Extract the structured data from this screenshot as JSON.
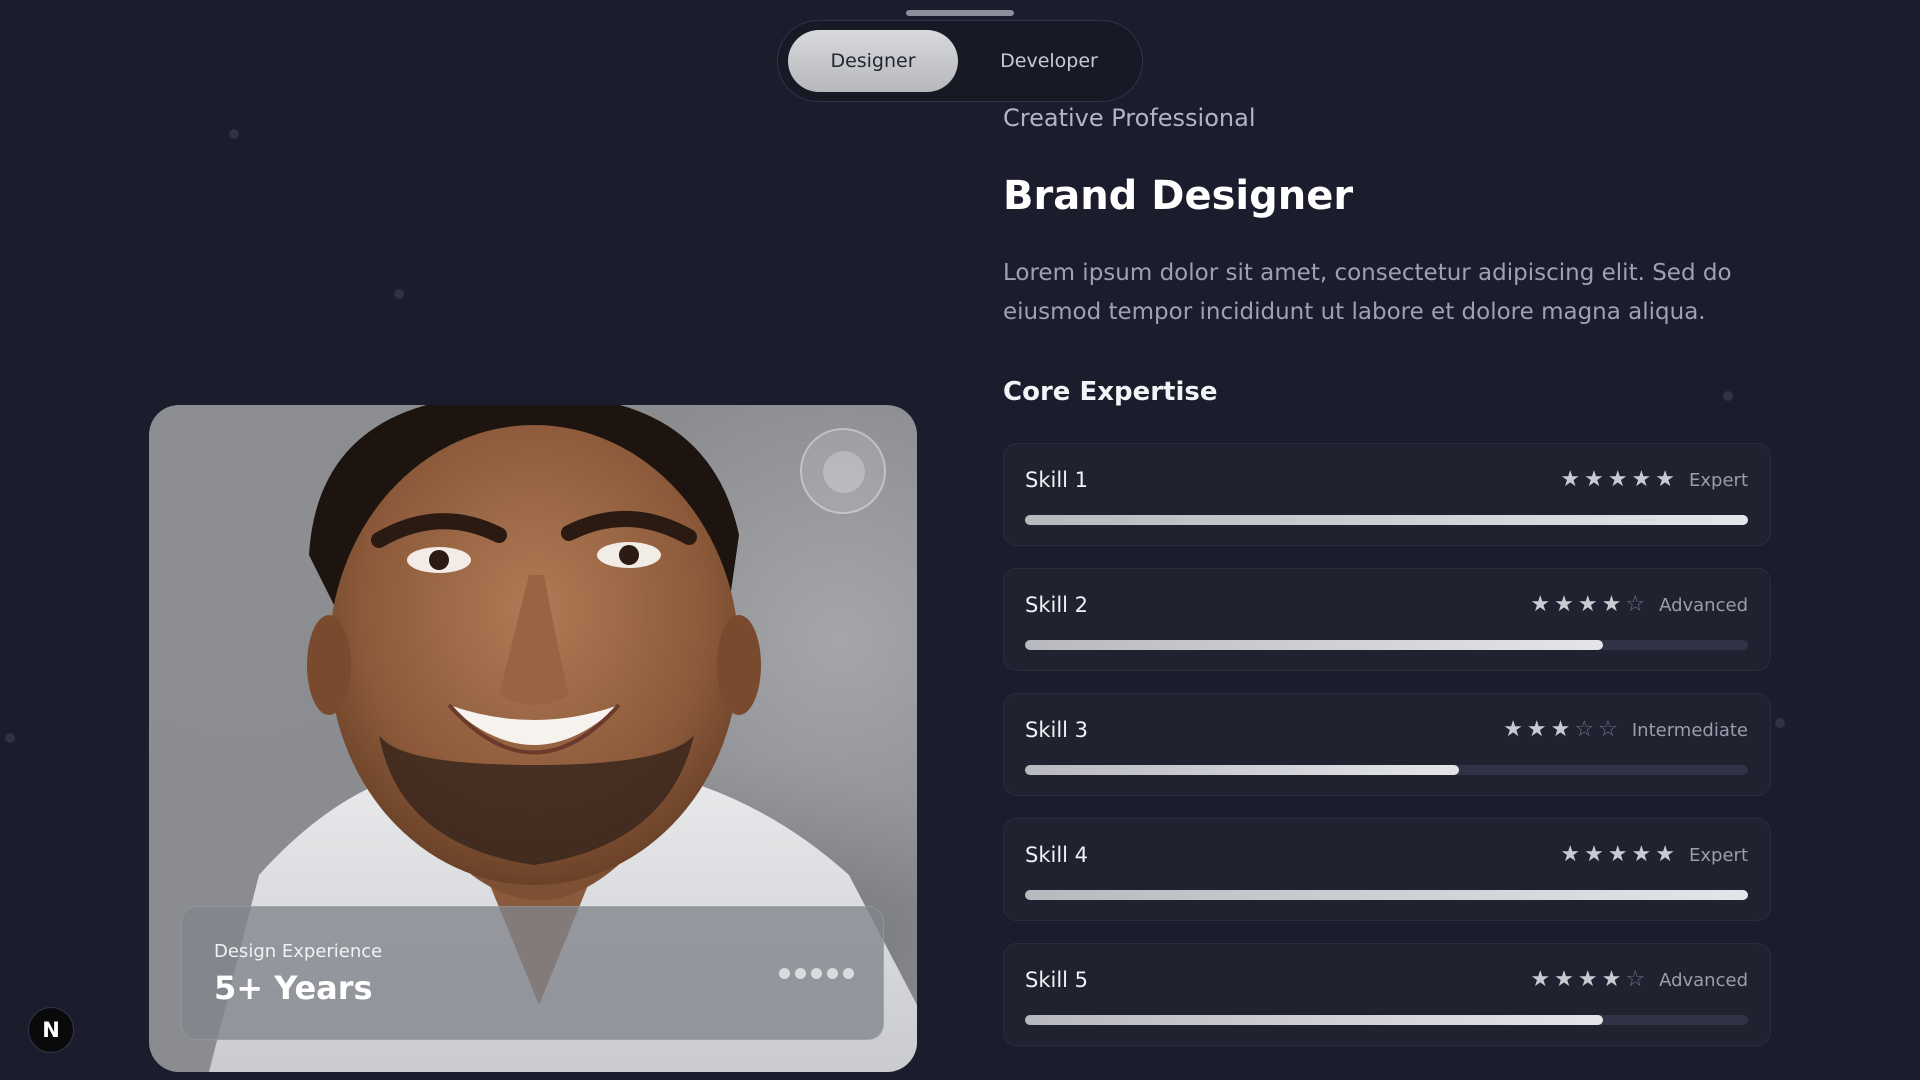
{
  "toggle": {
    "options": [
      {
        "label": "Designer",
        "active": true
      },
      {
        "label": "Developer",
        "active": false
      }
    ]
  },
  "profile": {
    "subtitle": "Creative Professional",
    "title": "Brand Designer",
    "description": "Lorem ipsum dolor sit amet, consectetur adipiscing elit. Sed do eiusmod tempor incididunt ut labore et dolore magna aliqua."
  },
  "photo_card": {
    "experience_label": "Design Experience",
    "experience_value": "5+ Years"
  },
  "expertise": {
    "title": "Core Expertise",
    "skills": [
      {
        "name": "Skill 1",
        "stars": 5,
        "max_stars": 5,
        "level": "Expert",
        "progress": 1.0
      },
      {
        "name": "Skill 2",
        "stars": 4,
        "max_stars": 5,
        "level": "Advanced",
        "progress": 0.8
      },
      {
        "name": "Skill 3",
        "stars": 3,
        "max_stars": 5,
        "level": "Intermediate",
        "progress": 0.6
      },
      {
        "name": "Skill 4",
        "stars": 5,
        "max_stars": 5,
        "level": "Expert",
        "progress": 1.0
      },
      {
        "name": "Skill 5",
        "stars": 4,
        "max_stars": 5,
        "level": "Advanced",
        "progress": 0.8
      }
    ]
  },
  "badge": {
    "label": "N"
  },
  "colors": {
    "background": "#1b1d2c",
    "card": "#202230",
    "accent_fill": "#d8d9dc"
  }
}
